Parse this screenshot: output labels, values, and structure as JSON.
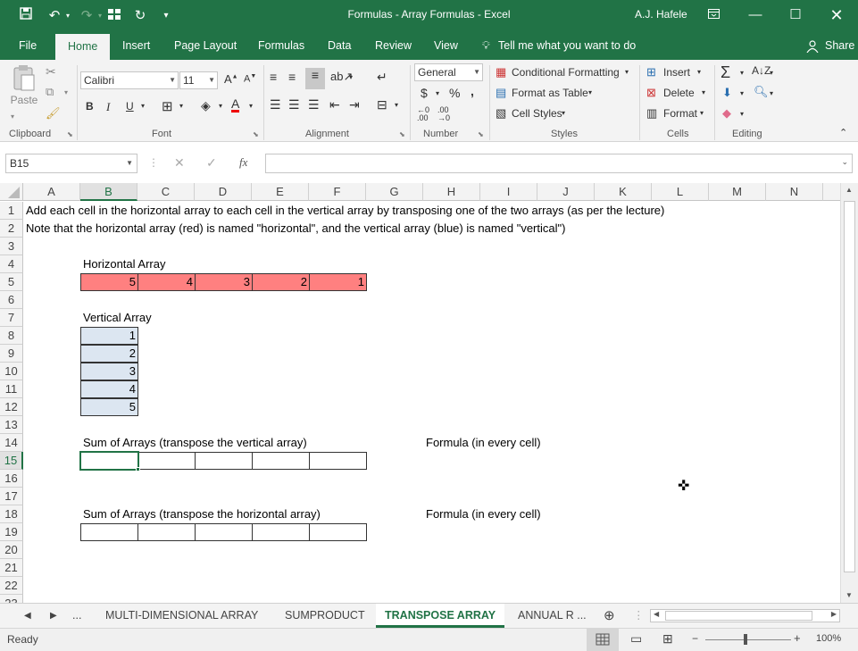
{
  "window": {
    "title": "Formulas - Array Formulas  -  Excel",
    "user": "A.J. Hafele",
    "accent": "#217346"
  },
  "quick_access": {
    "icons": [
      "save-icon",
      "undo-icon",
      "redo-icon",
      "grid-icon",
      "refresh-icon",
      "customize-icon"
    ]
  },
  "ribbon_tabs": [
    "File",
    "Home",
    "Insert",
    "Page Layout",
    "Formulas",
    "Data",
    "Review",
    "View"
  ],
  "active_tab": "Home",
  "tell_me": "Tell me what you want to do",
  "share": "Share",
  "ribbon": {
    "clipboard": {
      "label": "Clipboard",
      "paste": "Paste"
    },
    "font": {
      "label": "Font",
      "name": "Calibri",
      "size": "11",
      "bold": "B",
      "italic": "I",
      "underline": "U"
    },
    "alignment": {
      "label": "Alignment"
    },
    "number": {
      "label": "Number",
      "format": "General",
      "currency": "$",
      "percent": "%",
      "comma": ","
    },
    "styles": {
      "label": "Styles",
      "conditional": "Conditional Formatting",
      "table": "Format as Table",
      "cell_styles": "Cell Styles"
    },
    "cells": {
      "label": "Cells",
      "insert": "Insert",
      "delete": "Delete",
      "format": "Format"
    },
    "editing": {
      "label": "Editing"
    }
  },
  "formula_bar": {
    "name_box": "B15",
    "fx": "fx",
    "value": ""
  },
  "columns": [
    "A",
    "B",
    "C",
    "D",
    "E",
    "F",
    "G",
    "H",
    "I",
    "J",
    "K",
    "L",
    "M",
    "N"
  ],
  "selected_column": "B",
  "rows": [
    "1",
    "2",
    "3",
    "4",
    "5",
    "6",
    "7",
    "8",
    "9",
    "10",
    "11",
    "12",
    "13",
    "14",
    "15",
    "16",
    "17",
    "18",
    "19",
    "20",
    "21",
    "22",
    "23"
  ],
  "selected_row": "15",
  "cells": {
    "A1": "Add each cell in the horizontal array to each cell in the vertical array by transposing one of the two arrays (as per the lecture)",
    "A2": "Note that the horizontal array (red) is named \"horizontal\", and the vertical array (blue) is named \"vertical\")",
    "B4": "Horizontal Array",
    "horizontal_values": [
      "5",
      "4",
      "3",
      "2",
      "1"
    ],
    "B7": "Vertical Array",
    "vertical_values": [
      "1",
      "2",
      "3",
      "4",
      "5"
    ],
    "B14": "Sum of Arrays (transpose the vertical array)",
    "H14": "Formula (in every cell)",
    "B18": "Sum of Arrays (transpose the horizontal array)",
    "H18": "Formula (in every cell)"
  },
  "colors": {
    "horizontal_fill": "#ff8080",
    "vertical_fill": "#dce6f1"
  },
  "sheet_tabs": [
    "...",
    "MULTI-DIMENSIONAL ARRAY",
    "SUMPRODUCT",
    "TRANSPOSE ARRAY",
    "ANNUAL R ..."
  ],
  "active_sheet": "TRANSPOSE ARRAY",
  "status": {
    "ready": "Ready",
    "zoom": "100%"
  }
}
